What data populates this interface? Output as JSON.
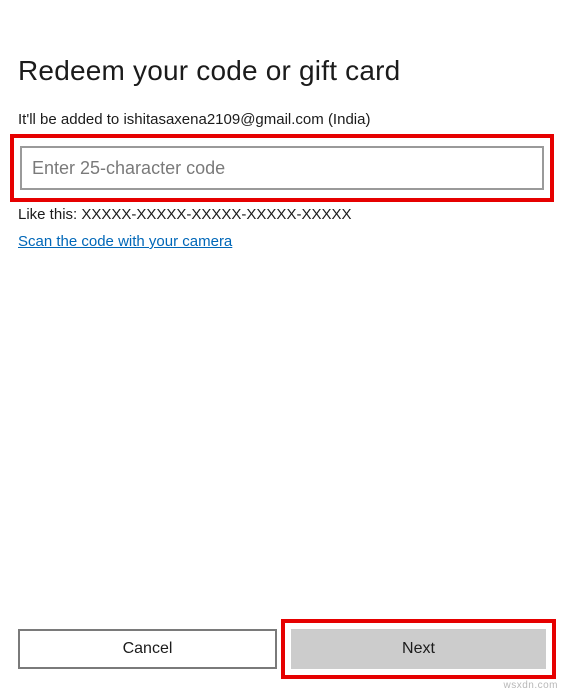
{
  "title": "Redeem your code or gift card",
  "subtitle": "It'll be added to ishitasaxena2109@gmail.com (India)",
  "input": {
    "placeholder": "Enter 25-character code",
    "value": ""
  },
  "example": "Like this: XXXXX-XXXXX-XXXXX-XXXXX-XXXXX",
  "scan_link": "Scan the code with your camera",
  "buttons": {
    "cancel": "Cancel",
    "next": "Next"
  },
  "watermark": "wsxdn.com"
}
